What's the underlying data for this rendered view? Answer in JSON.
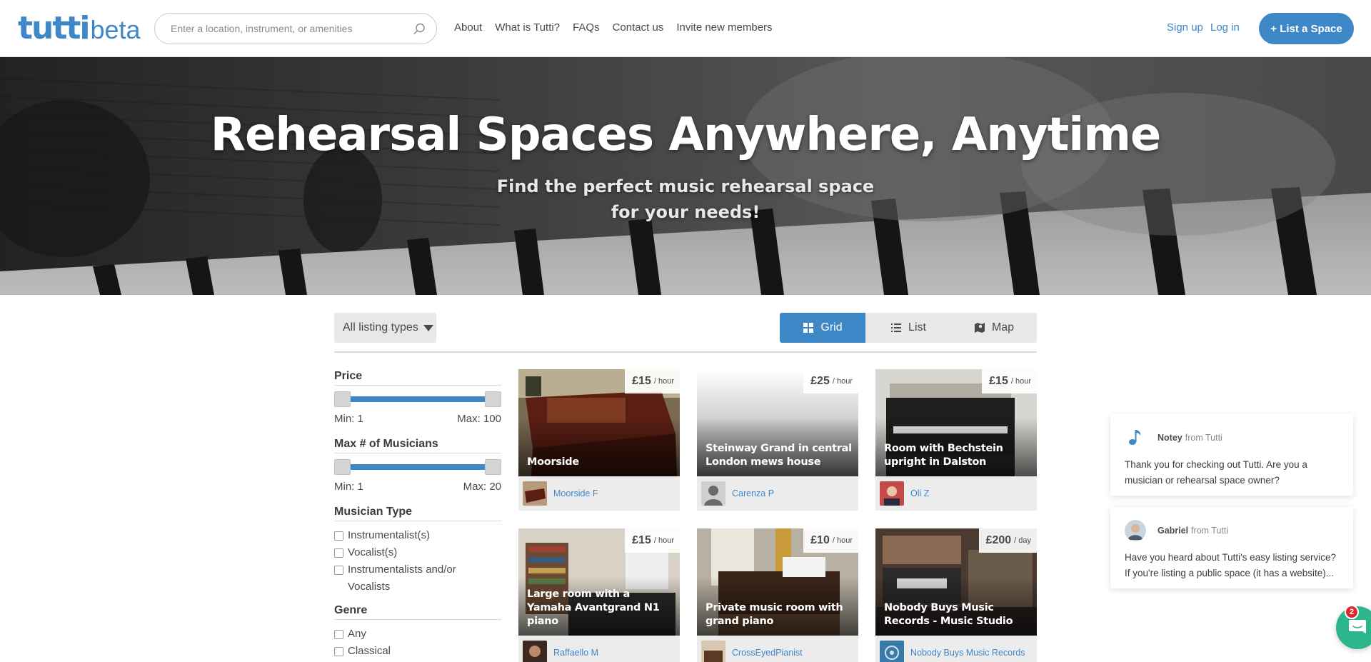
{
  "header": {
    "logo_main": "tutti",
    "logo_beta": "beta",
    "search_placeholder": "Enter a location, instrument, or amenities",
    "nav": [
      "About",
      "What is Tutti?",
      "FAQs",
      "Contact us",
      "Invite new members"
    ],
    "signup": "Sign up",
    "login": "Log in",
    "list_space": "+ List a Space"
  },
  "hero": {
    "title": "Rehearsal Spaces Anywhere, Anytime",
    "subtitle": "Find the perfect music rehearsal space for your needs!"
  },
  "toolbar": {
    "listing_type": "All listing types",
    "views": [
      "Grid",
      "List",
      "Map"
    ],
    "active_view": "Grid"
  },
  "filters": {
    "price": {
      "heading": "Price",
      "min": "Min: 1",
      "max": "Max: 100"
    },
    "musicians": {
      "heading": "Max # of Musicians",
      "min": "Min: 1",
      "max": "Max: 20"
    },
    "musician_type": {
      "heading": "Musician Type",
      "options": [
        "Instrumentalist(s)",
        "Vocalist(s)",
        "Instrumentalists and/or Vocalists"
      ]
    },
    "genre": {
      "heading": "Genre",
      "options": [
        "Any",
        "Classical"
      ]
    }
  },
  "listings": [
    {
      "title": "Moorside",
      "price": "£15",
      "unit": "/ hour",
      "owner": "Moorside F"
    },
    {
      "title": "Steinway Grand in central London mews house",
      "price": "£25",
      "unit": "/ hour",
      "owner": "Carenza P"
    },
    {
      "title": "Room with Bechstein upright in Dalston",
      "price": "£15",
      "unit": "/ hour",
      "owner": "Oli Z"
    },
    {
      "title": "Large room with a Yamaha Avantgrand N1 piano",
      "price": "£15",
      "unit": "/ hour",
      "owner": "Raffaello M"
    },
    {
      "title": "Private music room with grand piano",
      "price": "£10",
      "unit": "/ hour",
      "owner": "CrossEyedPianist"
    },
    {
      "title": "Nobody Buys Music Records - Music Studio",
      "price": "£200",
      "unit": "/ day",
      "owner": "Nobody Buys Music Records"
    }
  ],
  "chat": {
    "messages": [
      {
        "sender": "Notey",
        "from_label": "from Tutti",
        "text": "Thank you for checking out Tutti. Are you a musician or rehearsal space owner?"
      },
      {
        "sender": "Gabriel",
        "from_label": "from Tutti",
        "text": "Have you heard about Tutti's easy listing service? If you're listing a public space (it has a website)..."
      }
    ],
    "badge_count": "2"
  },
  "colors": {
    "brand": "#3e88c8",
    "chat_launcher": "#2db58b",
    "badge": "#e0262b"
  }
}
